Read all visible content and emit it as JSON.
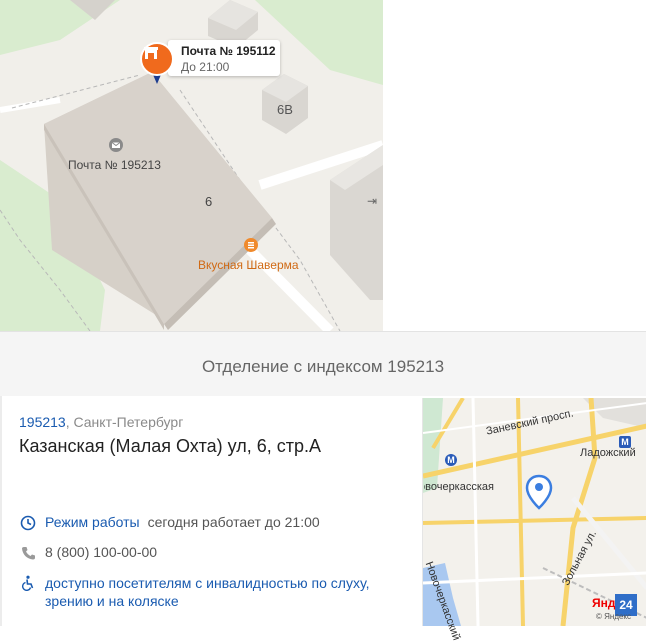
{
  "map": {
    "callout_title": "Почта № 195112",
    "callout_sub": "До 21:00",
    "post_label": "Почта № 195213",
    "building_number": "6",
    "building_6v": "6В",
    "shawarma_label": "Вкусная Шаверма",
    "colors": {
      "accent_orange": "#f06a1d",
      "pin_blue": "#1b3b8f"
    }
  },
  "section": {
    "title": "Отделение с индексом 195213"
  },
  "info": {
    "zip": "195213",
    "city": ", Санкт-Петербург",
    "address": "Казанская (Малая Охта) ул, 6, стр.А",
    "hours_label": "Режим работы",
    "hours_text": "сегодня работает до 21:00",
    "phone": "8 (800) 100-00-00",
    "access_line1": "доступно посетителям с инвалидностью по слуху,",
    "access_line2": "зрению и на коляске"
  },
  "mini_map": {
    "street1": "Заневский просп.",
    "station1": "Ладожский",
    "station2": "Новочеркасская",
    "street2": "Зольная ул.",
    "street3": "Новочеркасский",
    "logo": "Янд",
    "badge": "24",
    "copyright": "© Яндекс"
  }
}
